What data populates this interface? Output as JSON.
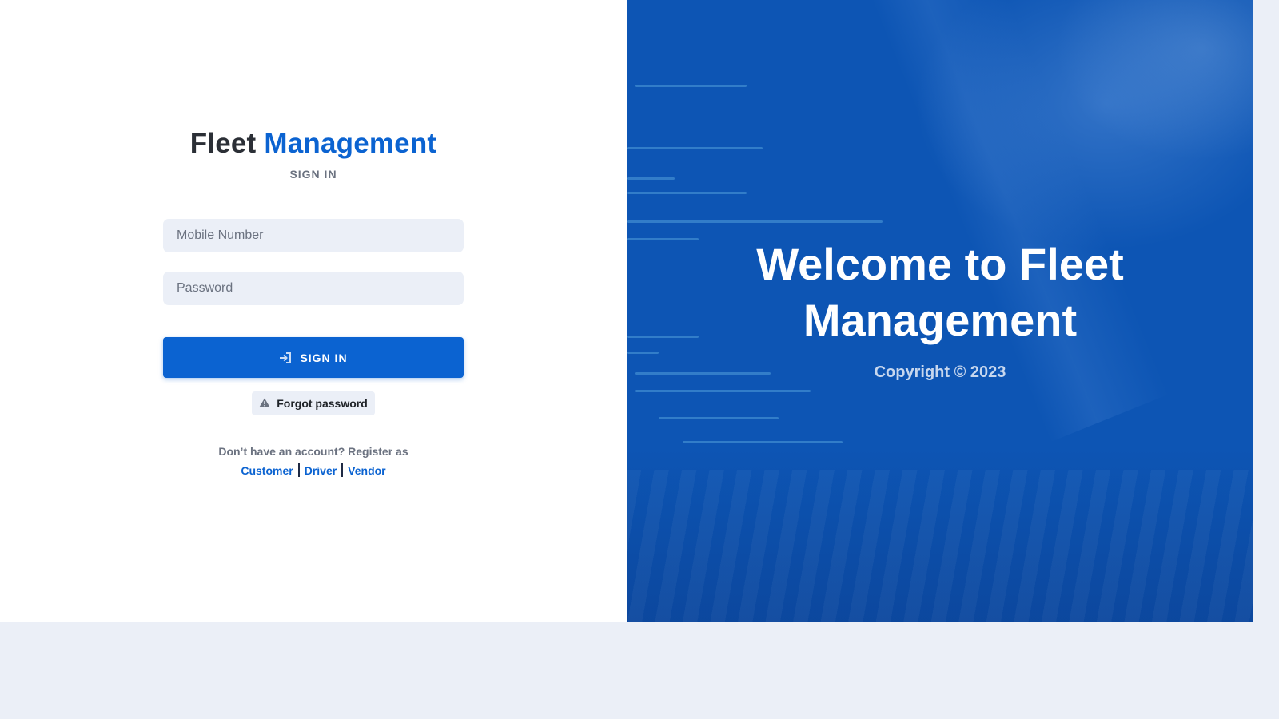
{
  "brand": {
    "name_part1": "Fleet",
    "name_part2": "Management"
  },
  "form": {
    "subtitle": "SIGN IN",
    "mobile_placeholder": "Mobile Number",
    "password_placeholder": "Password",
    "signin_label": "SIGN IN",
    "forgot_label": "Forgot password",
    "signin_icon": "sign-in-icon",
    "forgot_icon": "warning-icon"
  },
  "register": {
    "prompt": "Don’t have an account? Register as",
    "links": [
      "Customer",
      "Driver",
      "Vendor"
    ]
  },
  "hero": {
    "welcome": "Welcome to Fleet Management",
    "copyright": "Copyright © 2023"
  },
  "colors": {
    "accent": "#0b63d1",
    "hero_background": "#0d55b4",
    "input_background": "#ebeff7"
  }
}
